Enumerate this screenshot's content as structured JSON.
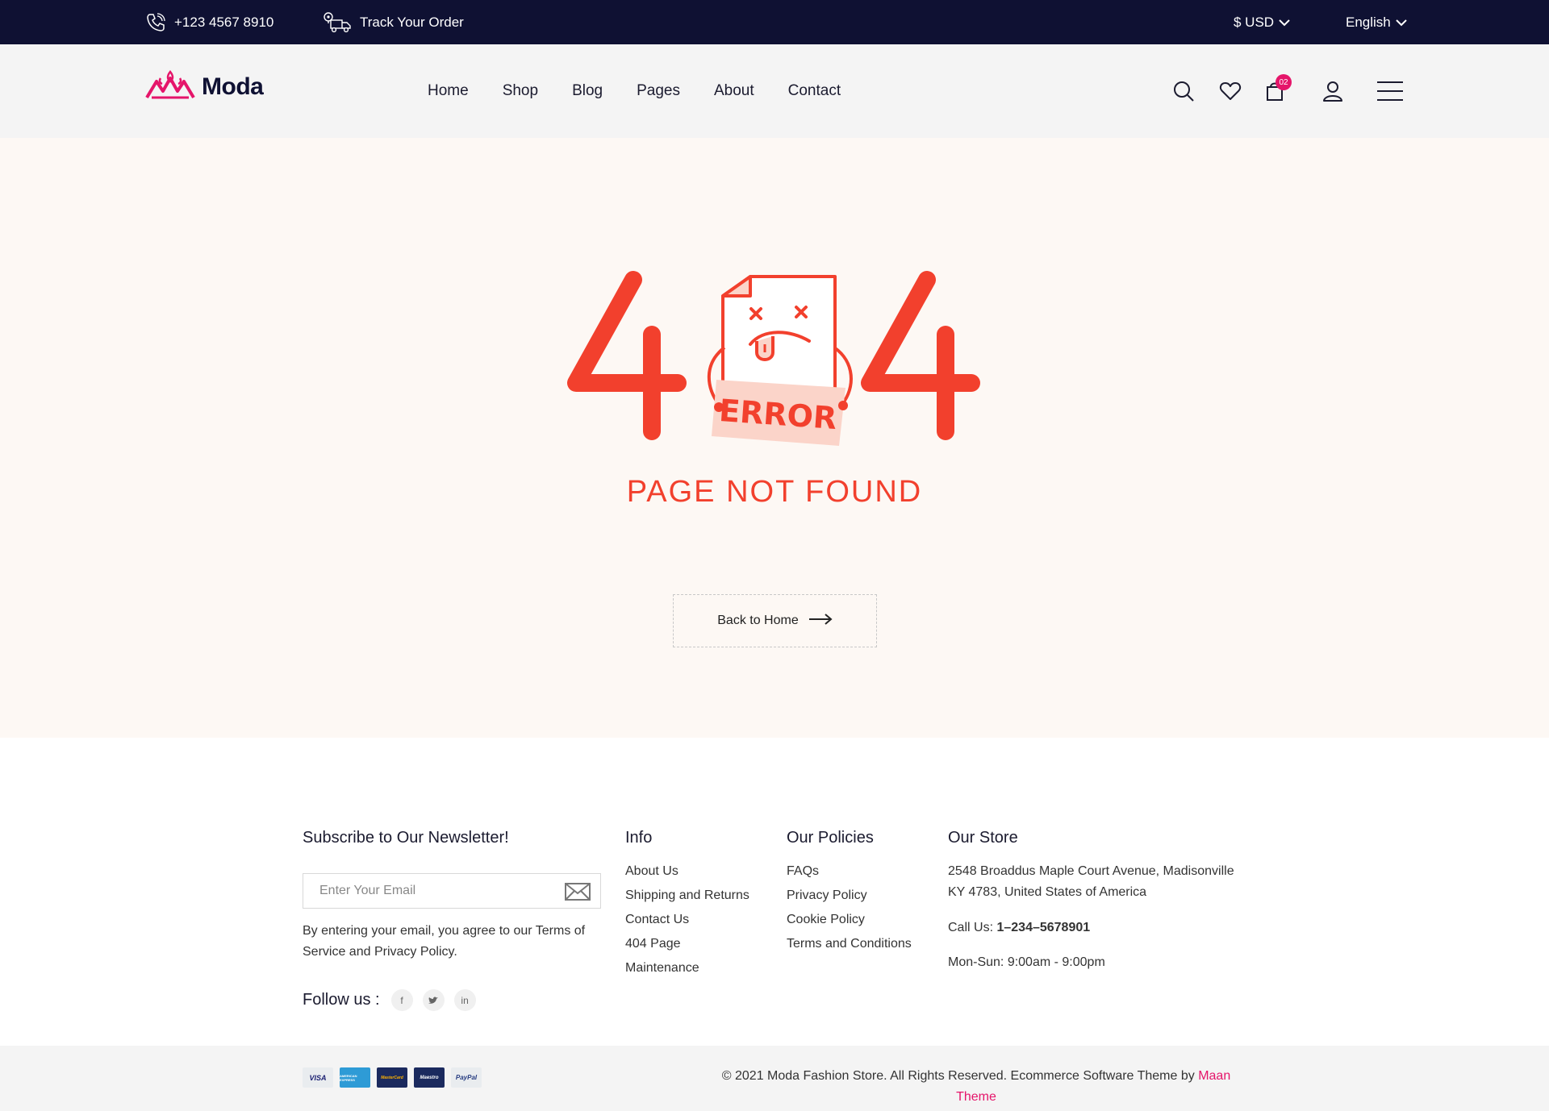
{
  "topbar": {
    "phone": "+123 4567 8910",
    "track_order": "Track Your Order",
    "currency": "$ USD",
    "language": "English"
  },
  "header": {
    "logo_text": "Moda",
    "nav": [
      "Home",
      "Shop",
      "Blog",
      "Pages",
      "About",
      "Contact"
    ],
    "cart_count": "02",
    "icons": [
      "search-icon",
      "heart-icon",
      "cart-icon",
      "user-icon",
      "menu-icon"
    ]
  },
  "error": {
    "graphic_label": "ERROR",
    "title": "PAGE NOT FOUND",
    "back_button": "Back to Home",
    "accent": "#f2402d"
  },
  "footer": {
    "newsletter": {
      "title": "Subscribe to Our Newsletter!",
      "placeholder": "Enter Your Email",
      "note_line1": "By entering your email, you agree to our Terms of",
      "note_line2": "Service and Privacy Policy.",
      "follow_label": "Follow us :",
      "socials": [
        "f",
        "t",
        "in"
      ]
    },
    "info": {
      "title": "Info",
      "links": [
        "About Us",
        "Shipping and Returns",
        "Contact Us",
        "404 Page",
        "Maintenance"
      ]
    },
    "policies": {
      "title": "Our Policies",
      "links": [
        "FAQs",
        "Privacy Policy",
        "Cookie Policy",
        "Terms and Conditions"
      ]
    },
    "store": {
      "title": "Our Store",
      "address_line1": "2548 Broaddus Maple Court Avenue, Madisonville",
      "address_line2": "KY 4783, United States of America",
      "call_label": "Call Us:",
      "call_number": "1–234–5678901",
      "hours": "Mon-Sun: 9:00am - 9:00pm"
    }
  },
  "bottombar": {
    "payments": [
      "VISA",
      "AMERICAN EXPRESS",
      "MasterCard",
      "Maestro",
      "PayPal"
    ],
    "copyright_text": "© 2021 Moda Fashion Store. All Rights Reserved. Ecommerce Software Theme by",
    "copyright_brand_part1": "Maan",
    "copyright_brand_part2": "Theme",
    "brand_color": "#e5156a"
  }
}
